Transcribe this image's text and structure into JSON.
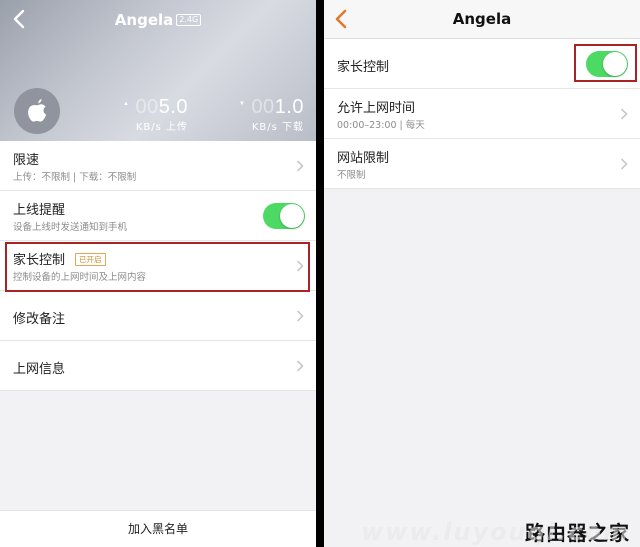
{
  "left": {
    "title": "Angela",
    "band_badge": "2.4G",
    "upload": {
      "dim": "00",
      "value": "5.0",
      "unit": "KB/s 上传"
    },
    "download": {
      "dim": "00",
      "value": "1.0",
      "unit": "KB/s 下载"
    },
    "rows": {
      "speed_limit": {
        "title": "限速",
        "subtitle": "上传：不限制 | 下载：不限制"
      },
      "online_alert": {
        "title": "上线提醒",
        "subtitle": "设备上线时发送通知到手机",
        "enabled": true
      },
      "parental": {
        "title": "家长控制",
        "tag": "已开启",
        "subtitle": "控制设备的上网时间及上网内容"
      },
      "rename": {
        "title": "修改备注"
      },
      "net_info": {
        "title": "上网信息"
      }
    },
    "blacklist_label": "加入黑名单"
  },
  "right": {
    "title": "Angela",
    "parental": {
      "title": "家长控制",
      "enabled": true
    },
    "allowed_time": {
      "title": "允许上网时间",
      "subtitle": "00:00–23:00 | 每天"
    },
    "site_limit": {
      "title": "网站限制",
      "subtitle": "不限制"
    }
  },
  "watermark": {
    "cn": "路由器之家",
    "en": "www.luyouqi.com"
  },
  "colors": {
    "toggle_on": "#4cd964",
    "highlight": "#a82323",
    "accent_orange": "#e07a2e"
  }
}
